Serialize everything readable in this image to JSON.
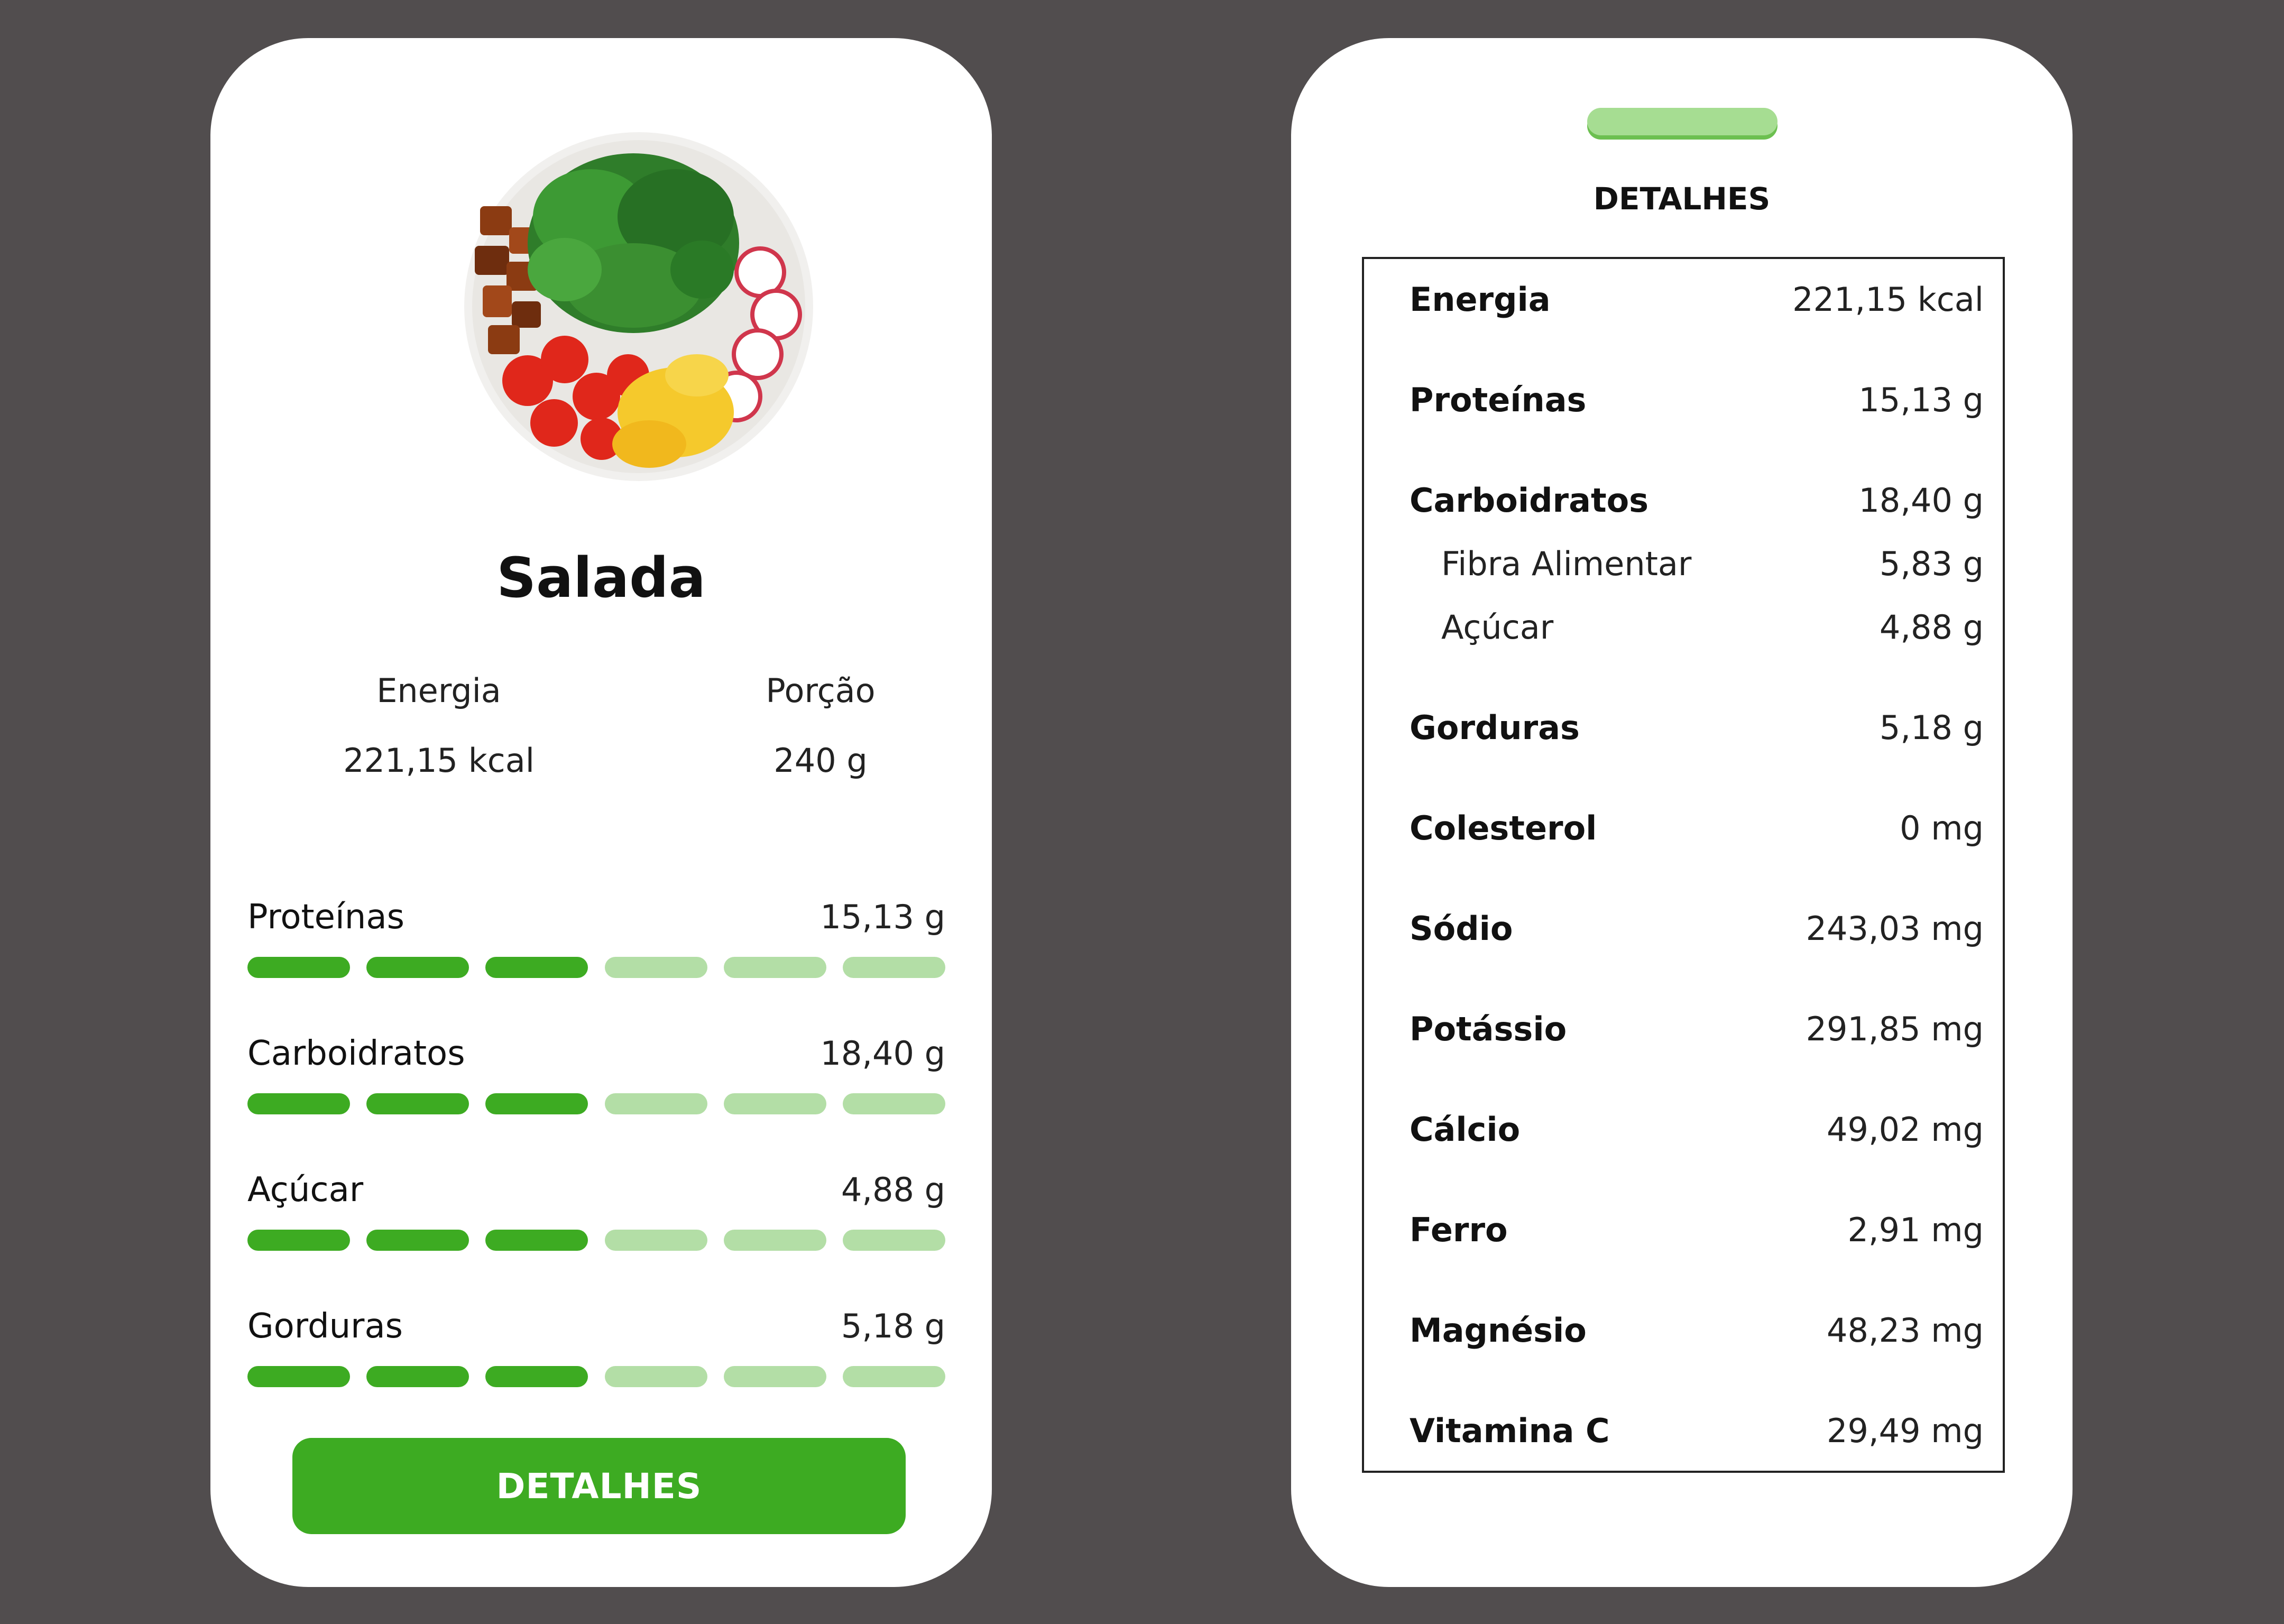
{
  "food": {
    "name": "Salada",
    "energy_label": "Energia",
    "energy_value": "221,15 kcal",
    "portion_label": "Porção",
    "portion_value": "240 g"
  },
  "nutrients": [
    {
      "name": "Proteínas",
      "value": "15,13 g",
      "level_segments": 3,
      "total_segments": 6
    },
    {
      "name": "Carboidratos",
      "value": "18,40 g",
      "level_segments": 3,
      "total_segments": 6
    },
    {
      "name": "Açúcar",
      "value": "4,88 g",
      "level_segments": 3,
      "total_segments": 6
    },
    {
      "name": "Gorduras",
      "value": "5,18 g",
      "level_segments": 3,
      "total_segments": 6
    }
  ],
  "button": {
    "label": "DETALHES"
  },
  "details": {
    "title": "DETALHES",
    "rows": [
      {
        "name": "Energia",
        "value": "221,15 kcal"
      },
      {
        "name": "Proteínas",
        "value": "15,13 g"
      },
      {
        "name": "Carboidratos",
        "value": "18,40 g"
      },
      {
        "name": "Fibra Alimentar",
        "value": "5,83 g",
        "sub": true
      },
      {
        "name": "Açúcar",
        "value": "4,88 g",
        "sub": true
      },
      {
        "name": "Gorduras",
        "value": "5,18 g"
      },
      {
        "name": "Colesterol",
        "value": "0 mg"
      },
      {
        "name": "Sódio",
        "value": "243,03 mg"
      },
      {
        "name": "Potássio",
        "value": "291,85 mg"
      },
      {
        "name": "Cálcio",
        "value": "49,02 mg"
      },
      {
        "name": "Ferro",
        "value": "2,91 mg"
      },
      {
        "name": "Magnésio",
        "value": "48,23 mg"
      },
      {
        "name": "Vitamina C",
        "value": "29,49 mg"
      }
    ]
  },
  "colors": {
    "background": "#514d4e",
    "bar_active": "#3dab22",
    "bar_inactive": "#b3dea6",
    "button": "#3dab22",
    "handle": "#a6dd92"
  },
  "icons": {
    "food_image": "salad-bowl-image"
  }
}
